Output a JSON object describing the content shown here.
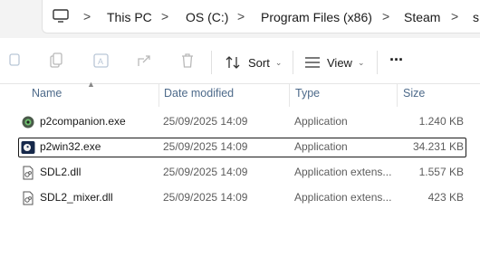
{
  "address": {
    "crumbs": [
      "This PC",
      "OS (C:)",
      "Program Files (x86)",
      "Steam",
      "s"
    ],
    "separator": ">"
  },
  "toolbar": {
    "sort_label": "Sort",
    "view_label": "View",
    "more_label": "···"
  },
  "columns": {
    "name": "Name",
    "date": "Date modified",
    "type": "Type",
    "size": "Size"
  },
  "files": [
    {
      "name": "p2companion.exe",
      "date": "25/09/2025 14:09",
      "type": "Application",
      "size": "1.240 KB",
      "icon": "exe-app-icon"
    },
    {
      "name": "p2win32.exe",
      "date": "25/09/2025 14:09",
      "type": "Application",
      "size": "34.231 KB",
      "icon": "exe-app-icon",
      "selected": true
    },
    {
      "name": "SDL2.dll",
      "date": "25/09/2025 14:09",
      "type": "Application extens...",
      "size": "1.557 KB",
      "icon": "dll-file-icon"
    },
    {
      "name": "SDL2_mixer.dll",
      "date": "25/09/2025 14:09",
      "type": "Application extens...",
      "size": "423 KB",
      "icon": "dll-file-icon"
    }
  ]
}
